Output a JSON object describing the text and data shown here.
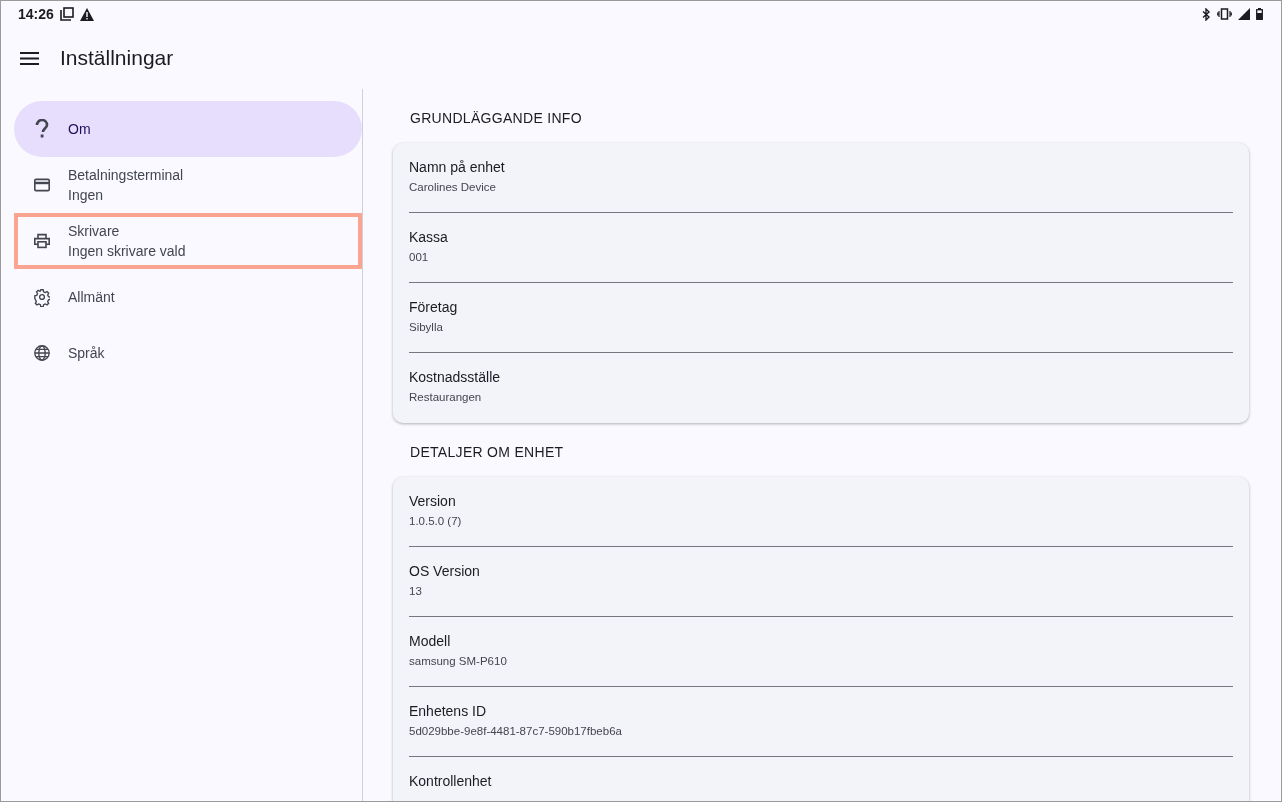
{
  "status_bar": {
    "time": "14:26"
  },
  "app_bar": {
    "title": "Inställningar"
  },
  "sidebar": {
    "items": [
      {
        "label": "Om",
        "selected": true,
        "highlighted": false
      },
      {
        "label": "Betalningsterminal",
        "sublabel": "Ingen",
        "selected": false,
        "highlighted": false
      },
      {
        "label": "Skrivare",
        "sublabel": "Ingen skrivare vald",
        "selected": false,
        "highlighted": true
      },
      {
        "label": "Allmänt",
        "selected": false,
        "highlighted": false
      },
      {
        "label": "Språk",
        "selected": false,
        "highlighted": false
      }
    ]
  },
  "sections": [
    {
      "title": "GRUNDLÄGGANDE INFO",
      "rows": [
        {
          "label": "Namn på enhet",
          "value": "Carolines Device"
        },
        {
          "label": "Kassa",
          "value": "001"
        },
        {
          "label": "Företag",
          "value": "Sibylla"
        },
        {
          "label": "Kostnadsställe",
          "value": "Restaurangen"
        }
      ]
    },
    {
      "title": "DETALJER OM ENHET",
      "rows": [
        {
          "label": "Version",
          "value": "1.0.5.0 (7)"
        },
        {
          "label": "OS Version",
          "value": "13"
        },
        {
          "label": "Modell",
          "value": "samsung SM-P610"
        },
        {
          "label": "Enhetens ID",
          "value": "5d029bbe-9e8f-4481-87c7-590b17fbeb6a"
        },
        {
          "label": "Kontrollenhet"
        }
      ]
    }
  ]
}
